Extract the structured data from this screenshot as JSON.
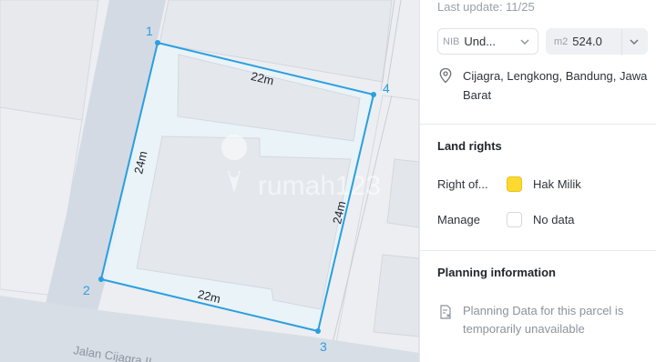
{
  "map": {
    "vertex_labels": [
      "1",
      "2",
      "3",
      "4"
    ],
    "edge_lengths": [
      "22m",
      "24m",
      "22m",
      "24m"
    ],
    "street_name": "Jalan Cijagra II",
    "watermark": "rumah123",
    "colors": {
      "parcel_line": "#2a9fe0",
      "parcel_fill": "#e9f2f8",
      "road": "#d3dae3",
      "building": "#e3e6ea"
    }
  },
  "panel": {
    "last_update": "Last update: 11/25",
    "nib": {
      "prefix": "NIB",
      "value": "Und..."
    },
    "area": {
      "prefix": "m2",
      "value": "524.0"
    },
    "address": "Cijagra, Lengkong, Bandung, Jawa Barat",
    "land_rights": {
      "title": "Land rights",
      "rows": [
        {
          "label": "Right of...",
          "value": "Hak Milik",
          "swatch": "#fcd92f"
        },
        {
          "label": "Manage",
          "value": "No data",
          "swatch": "#ffffff"
        }
      ]
    },
    "planning": {
      "title": "Planning information",
      "message": "Planning Data for this parcel is temporarily unavailable"
    }
  }
}
